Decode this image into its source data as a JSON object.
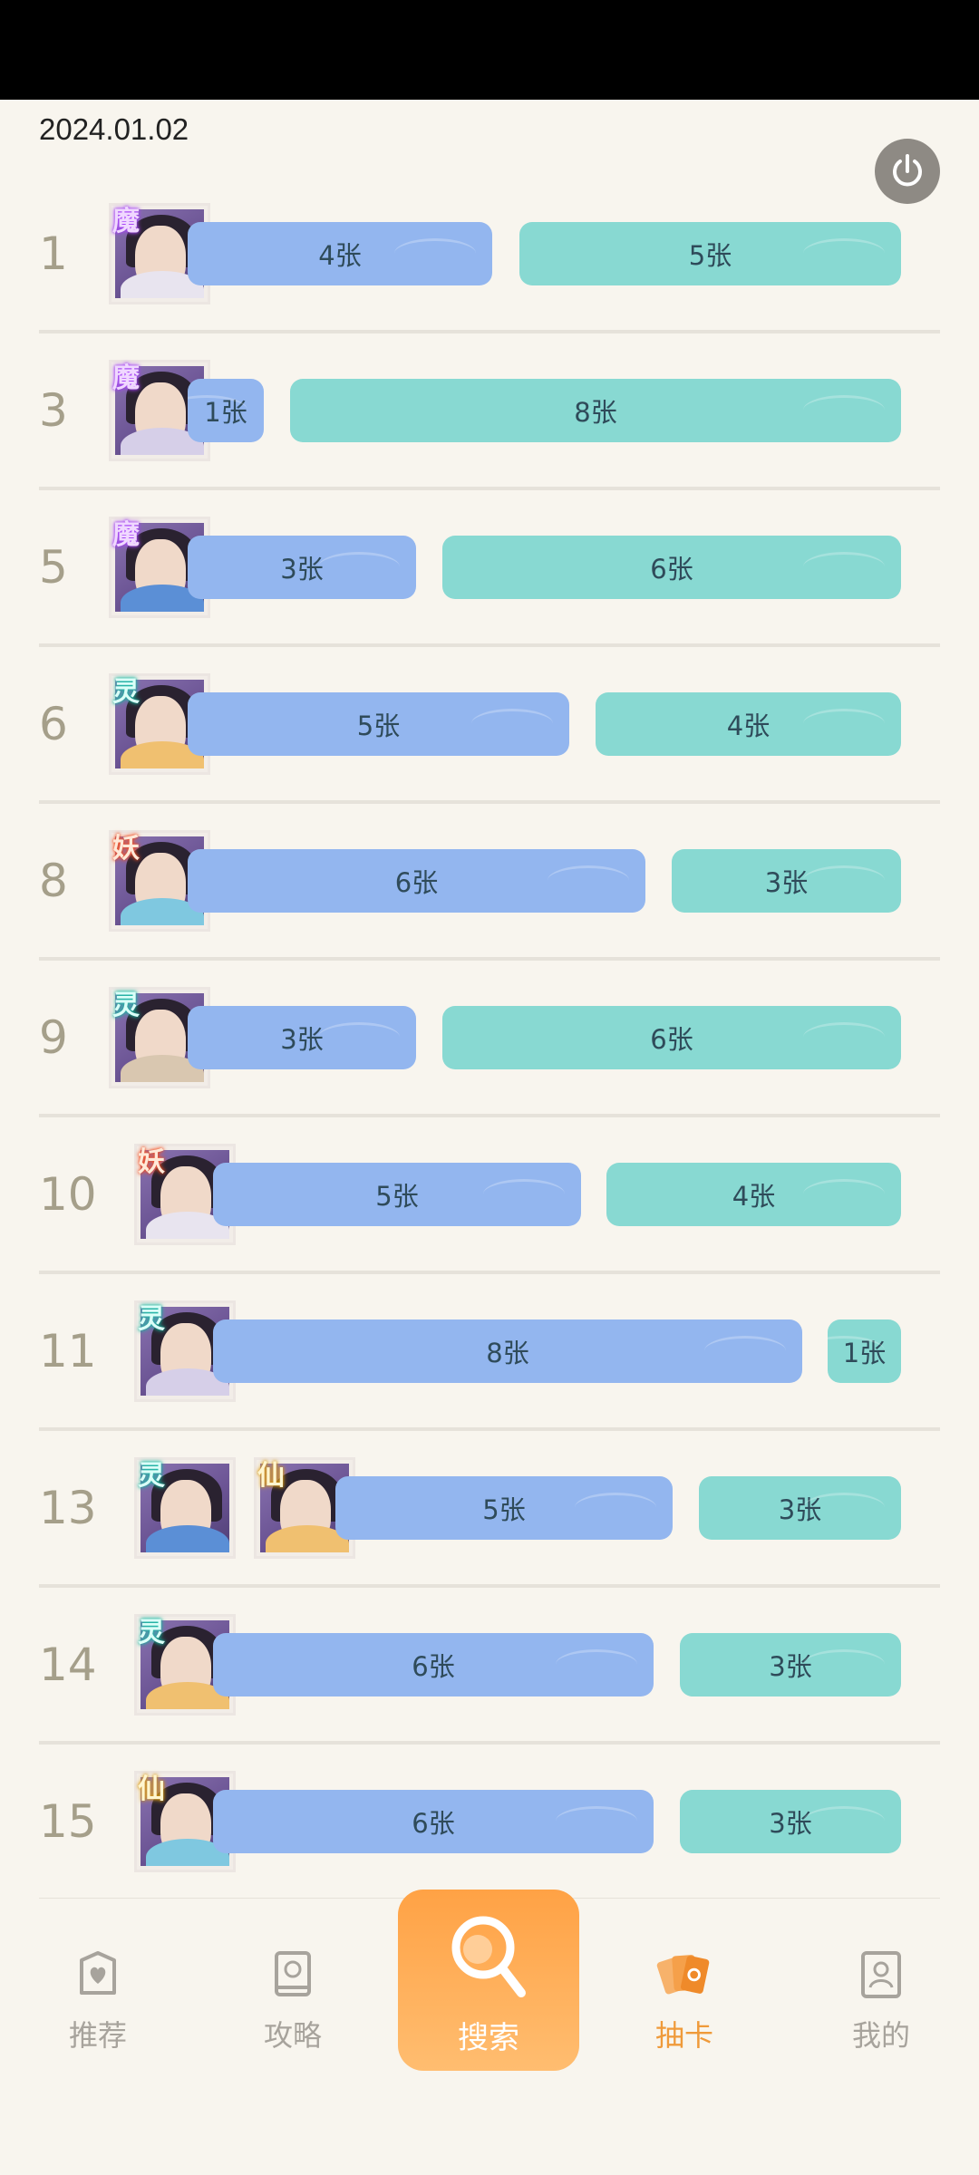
{
  "date": "2024.01.02",
  "rows": [
    {
      "num": "1",
      "avatars": [
        {
          "faction": "魔"
        }
      ],
      "bars": [
        {
          "label": "4张",
          "color": "blue"
        },
        {
          "label": "5张",
          "color": "teal"
        }
      ]
    },
    {
      "num": "3",
      "avatars": [
        {
          "faction": "魔"
        }
      ],
      "bars": [
        {
          "label": "1张",
          "color": "blue"
        },
        {
          "label": "8张",
          "color": "teal"
        }
      ]
    },
    {
      "num": "5",
      "avatars": [
        {
          "faction": "魔"
        }
      ],
      "bars": [
        {
          "label": "3张",
          "color": "blue"
        },
        {
          "label": "6张",
          "color": "teal"
        }
      ]
    },
    {
      "num": "6",
      "avatars": [
        {
          "faction": "灵"
        }
      ],
      "bars": [
        {
          "label": "5张",
          "color": "blue"
        },
        {
          "label": "4张",
          "color": "teal"
        }
      ]
    },
    {
      "num": "8",
      "avatars": [
        {
          "faction": "妖"
        }
      ],
      "bars": [
        {
          "label": "6张",
          "color": "blue"
        },
        {
          "label": "3张",
          "color": "teal"
        }
      ]
    },
    {
      "num": "9",
      "avatars": [
        {
          "faction": "灵"
        }
      ],
      "bars": [
        {
          "label": "3张",
          "color": "blue"
        },
        {
          "label": "6张",
          "color": "teal"
        }
      ]
    },
    {
      "num": "10",
      "avatars": [
        {
          "faction": "妖"
        }
      ],
      "bars": [
        {
          "label": "5张",
          "color": "blue"
        },
        {
          "label": "4张",
          "color": "teal"
        }
      ]
    },
    {
      "num": "11",
      "avatars": [
        {
          "faction": "灵"
        }
      ],
      "bars": [
        {
          "label": "8张",
          "color": "blue"
        },
        {
          "label": "1张",
          "color": "teal"
        }
      ]
    },
    {
      "num": "13",
      "avatars": [
        {
          "faction": "灵"
        },
        {
          "faction": "仙"
        }
      ],
      "bars": [
        {
          "label": "5张",
          "color": "blue"
        },
        {
          "label": "3张",
          "color": "teal"
        }
      ]
    },
    {
      "num": "14",
      "avatars": [
        {
          "faction": "灵"
        }
      ],
      "bars": [
        {
          "label": "6张",
          "color": "blue"
        },
        {
          "label": "3张",
          "color": "teal"
        }
      ]
    },
    {
      "num": "15",
      "avatars": [
        {
          "faction": "仙"
        }
      ],
      "bars": [
        {
          "label": "6张",
          "color": "blue"
        },
        {
          "label": "3张",
          "color": "teal"
        }
      ]
    }
  ],
  "tabs": [
    {
      "label": "推荐",
      "icon": "heart-card-icon",
      "active": false
    },
    {
      "label": "攻略",
      "icon": "book-icon",
      "active": false
    },
    {
      "label": "搜索",
      "icon": "search-icon",
      "active": false
    },
    {
      "label": "抽卡",
      "icon": "cards-icon",
      "active": true
    },
    {
      "label": "我的",
      "icon": "profile-icon",
      "active": false
    }
  ],
  "colors": {
    "blue_bar": "#93b6ef",
    "teal_bar": "#88d9d2",
    "accent": "#ef9a3a",
    "search_tab": "#ffa245"
  }
}
